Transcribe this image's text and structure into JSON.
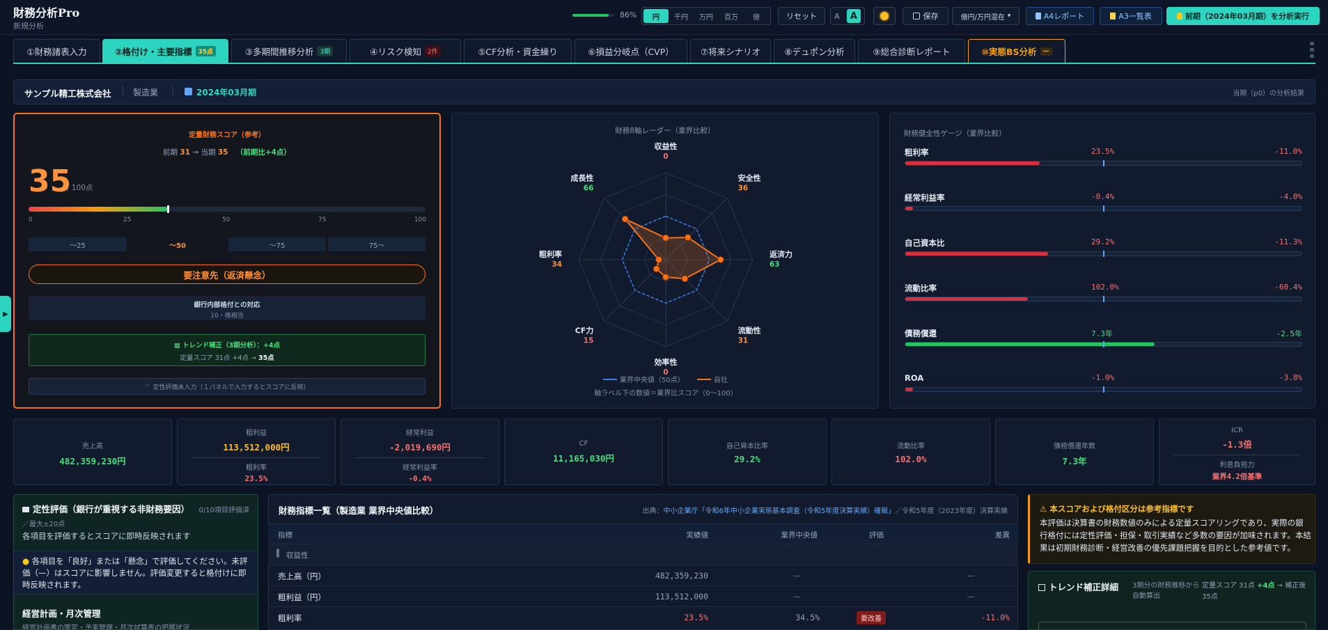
{
  "app": {
    "title": "財務分析Pro",
    "subtitle": "新規分析"
  },
  "toolbar": {
    "progress_pct": 86,
    "progress_label": "86%",
    "units": [
      "円",
      "千円",
      "万円",
      "百万",
      "億"
    ],
    "active_unit": "円",
    "reset_label": "リセット",
    "font_small": "A",
    "font_large": "A",
    "theme_icon": "sun-icon",
    "save_label": "保存",
    "display_select": "億円/万円混在",
    "a4_label": "A4レポート",
    "a3_label": "A3一覧表",
    "run_label": "前期（2024年03月期）を分析実行"
  },
  "tabs": [
    {
      "label": "①財務諸表入力",
      "badge": ""
    },
    {
      "label": "②格付け・主要指標",
      "badge": "35点"
    },
    {
      "label": "③多期間推移分析",
      "badge": "3期"
    },
    {
      "label": "④リスク検知",
      "badge": "2件"
    },
    {
      "label": "⑤CF分析・資金繰り",
      "badge": ""
    },
    {
      "label": "⑥損益分岐点（CVP）",
      "badge": ""
    },
    {
      "label": "⑦将来シナリオ",
      "badge": ""
    },
    {
      "label": "⑧デュポン分析",
      "badge": ""
    },
    {
      "label": "⑨総合診断レポート",
      "badge": ""
    },
    {
      "label": "⑩実態BS分析",
      "badge": "—"
    }
  ],
  "company": {
    "name": "サンプル精工株式会社",
    "industry": "製造業",
    "period": "2024年03月期",
    "note": "当期（p0）の分析結果"
  },
  "score_card": {
    "title": "定量財務スコア（参考）",
    "prev_label": "前期",
    "prev_value": "31",
    "arrow": "→",
    "curr_label": "当期",
    "curr_value": "35",
    "change": "（前期比+4点）",
    "score": "35",
    "score_unit": "/ 100点",
    "score_fraction": 0.35,
    "scale_ticks": [
      "0",
      "25",
      "50",
      "75",
      "100"
    ],
    "scale_bands": [
      "〜25",
      "〜50",
      "〜75",
      "75〜"
    ],
    "verdict": "要注意先（返済懸念）",
    "bank_title": "銀行内部格付との対応",
    "bank_value": "10・格相当",
    "trend_title": "トレンド補正（3期分析）：+4点",
    "trend_detail": "定量スコア 31点 +4点 → ",
    "trend_result": "35点",
    "qual_note": "定性評価未入力（１パネルで入力するとスコアに反映）"
  },
  "radar": {
    "title": "財務8軸レーダー（業界比較）",
    "axes": [
      {
        "name": "収益性",
        "score": "0"
      },
      {
        "name": "安全性",
        "score": "36"
      },
      {
        "name": "返済力",
        "score": "63"
      },
      {
        "name": "流動性",
        "score": "31"
      },
      {
        "name": "効率性",
        "score": "0"
      },
      {
        "name": "CF力",
        "score": "15"
      },
      {
        "name": "粗利率",
        "score": "34"
      },
      {
        "name": "成長性",
        "score": "66"
      }
    ],
    "self_values": [
      25,
      36,
      63,
      31,
      20,
      15,
      8,
      66
    ],
    "median_values": [
      50,
      50,
      50,
      50,
      50,
      50,
      50,
      50
    ],
    "legend_median": "業界中央値（50点）",
    "legend_self": "自社",
    "footnote": "軸ラベル下の数値＝業界比スコア（0〜100）"
  },
  "gauges": {
    "title": "財務健全性ゲージ（業界比較）",
    "items": [
      {
        "name": "粗利率",
        "value": "23.5%",
        "diff": "-11.0%",
        "level": 0.34,
        "color": "#dc2f3c"
      },
      {
        "name": "経常利益率",
        "value": "-0.4%",
        "diff": "-4.0%",
        "level": 0.02,
        "color": "#dc2f3c"
      },
      {
        "name": "自己資本比",
        "value": "29.2%",
        "diff": "-11.3%",
        "level": 0.36,
        "color": "#dc2f3c"
      },
      {
        "name": "流動比率",
        "value": "102.0%",
        "diff": "-60.4%",
        "level": 0.31,
        "color": "#dc2f3c"
      },
      {
        "name": "債務償還",
        "value": "7.3年",
        "diff": "-2.5年",
        "level": 0.63,
        "color": "#22c55e"
      },
      {
        "name": "ROA",
        "value": "-1.0%",
        "diff": "-3.8%",
        "level": 0.02,
        "color": "#dc2f3c"
      }
    ]
  },
  "kpis": [
    {
      "label": "売上高",
      "value": "482,359,230円",
      "color": "green",
      "sub_label": "",
      "sub_value": ""
    },
    {
      "label": "粗利益",
      "value": "113,512,000円",
      "color": "amber",
      "sub_label": "粗利率",
      "sub_value": "23.5%",
      "sub_color": "red"
    },
    {
      "label": "経常利益",
      "value": "-2,019,690円",
      "color": "red",
      "sub_label": "経常利益率",
      "sub_value": "-0.4%",
      "sub_color": "red"
    },
    {
      "label": "CF",
      "value": "11,165,030円",
      "color": "green",
      "sub_label": "",
      "sub_value": ""
    },
    {
      "label": "自己資本比率",
      "value": "29.2%",
      "color": "green",
      "sub_label": "",
      "sub_value": ""
    },
    {
      "label": "流動比率",
      "value": "102.0%",
      "color": "red",
      "sub_label": "",
      "sub_value": ""
    },
    {
      "label": "債務償還年数",
      "value": "7.3年",
      "color": "green",
      "sub_label": "",
      "sub_value": ""
    },
    {
      "label": "ICR",
      "value": "-1.3倍",
      "color": "red",
      "sub_label": "利息負担力",
      "sub_value": "業界4.2倍基準",
      "sub_color": "red"
    }
  ],
  "qualitative": {
    "title": "定性評価（銀行が重視する非財務要因）",
    "count": "0/10項目評価済",
    "max": "／最大±20点",
    "hint": "各項目を評価するとスコアに即時反映されます",
    "instruction": "各項目を「良好」または「懸念」で評価してください。未評価（—）はスコアに影響しません。評価変更すると格付けに即時反映されます。",
    "section": "経営計画・月次管理",
    "section_desc": "経営計画書の策定・予実管理・月次試算表の把握状況"
  },
  "indicator_table": {
    "title": "財務指標一覧（製造業 業界中央値比較）",
    "source_prefix": "出典：",
    "source_link": "中小企業庁「令和6年中小企業実態基本調査（令和5年度決算実績）確報」",
    "source_suffix": "／令和5年度（2023年度）決算実績",
    "headers": [
      "指標",
      "実績値",
      "業界中央値",
      "評価",
      "差異"
    ],
    "group": "収益性",
    "rows": [
      {
        "name": "売上高（円）",
        "actual": "482,359,230",
        "median": "—",
        "eval": "",
        "diff": "—"
      },
      {
        "name": "粗利益（円）",
        "actual": "113,512,000",
        "median": "—",
        "eval": "",
        "diff": "—"
      },
      {
        "name": "粗利率",
        "actual": "23.5%",
        "median": "34.5%",
        "eval": "要改善",
        "diff": "-11.0%"
      }
    ]
  },
  "notice": {
    "title": "本スコアおよび格付区分は参考指標です",
    "body": "本評価は決算書の財務数値のみによる定量スコアリングであり、実際の銀行格付には定性評価・担保・取引実績など多数の要因が加味されます。本結果は初期財務診断・経営改善の優先課題把握を目的とした参考値です。"
  },
  "trend_detail": {
    "title": "トレンド補正詳細",
    "desc": "3期分の財務推移から自動算出",
    "summary_pre": "定量スコア 31点",
    "summary_plus": "+4点",
    "summary_post": "→ 補正後 35点"
  }
}
